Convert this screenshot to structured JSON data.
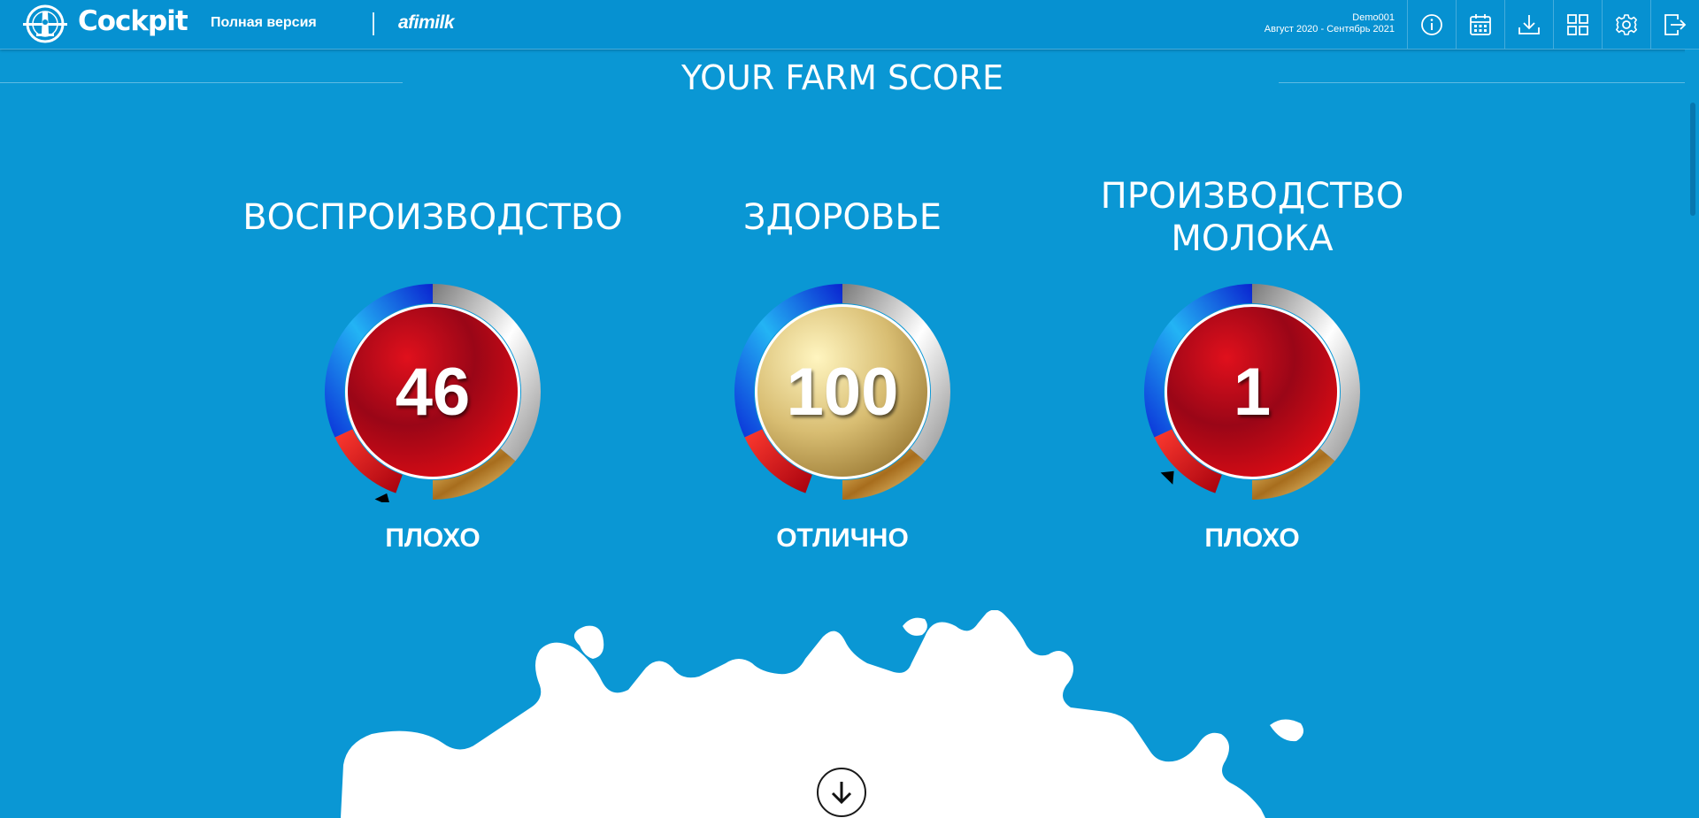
{
  "header": {
    "app_name": "Cockpit",
    "version_label": "Полная версия",
    "brand": "afimilk",
    "farm_name": "Demo001",
    "date_range": "Август 2020 - Сентябрь 2021",
    "icons": [
      "info-icon",
      "calendar-icon",
      "download-icon",
      "dashboard-grid-icon",
      "gear-icon",
      "logout-icon"
    ]
  },
  "page": {
    "title": "YOUR FARM SCORE"
  },
  "scores": [
    {
      "title_line1": "ВОСПРОИЗВОДСТВО",
      "title_line2": "",
      "value": "46",
      "rating": "ПЛОХО",
      "level": 0.46,
      "center_style": "red"
    },
    {
      "title_line1": "ЗДОРОВЬЕ",
      "title_line2": "",
      "value": "100",
      "rating": "ОТЛИЧНО",
      "level": 1.0,
      "center_style": "gold"
    },
    {
      "title_line1": "ПРОИЗВОДСТВО",
      "title_line2": "МОЛОКА",
      "value": "1",
      "rating": "ПЛОХО",
      "level": 0.01,
      "center_style": "red"
    }
  ],
  "colors": {
    "background": "#0a97d4",
    "poor": "#c8101e",
    "excellent": "#d4b96a"
  }
}
